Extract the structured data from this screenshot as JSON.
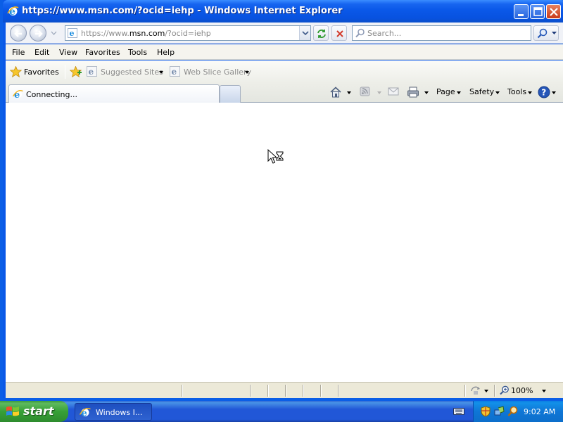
{
  "window": {
    "title": "https://www.msn.com/?ocid=iehp - Windows Internet Explorer"
  },
  "address_bar": {
    "url_prefix": "https://www.",
    "url_domain": "msn.com",
    "url_suffix": "/?ocid=iehp"
  },
  "search": {
    "placeholder": "Search..."
  },
  "menu": {
    "items": [
      "File",
      "Edit",
      "View",
      "Favorites",
      "Tools",
      "Help"
    ]
  },
  "favorites_bar": {
    "favorites_label": "Favorites",
    "suggested_sites": "Suggested Sites",
    "web_slice_gallery": "Web Slice Gallery"
  },
  "tabs": {
    "active_tab_label": "Connecting..."
  },
  "command_bar": {
    "page_label": "Page",
    "safety_label": "Safety",
    "tools_label": "Tools"
  },
  "status_bar": {
    "zoom": "100%"
  },
  "taskbar": {
    "start_label": "start",
    "task_label": "Windows I...",
    "clock": "9:02 AM"
  },
  "colors": {
    "titlebar": "#0A58E8",
    "taskbar": "#2157D7",
    "start_button": "#37A037"
  }
}
